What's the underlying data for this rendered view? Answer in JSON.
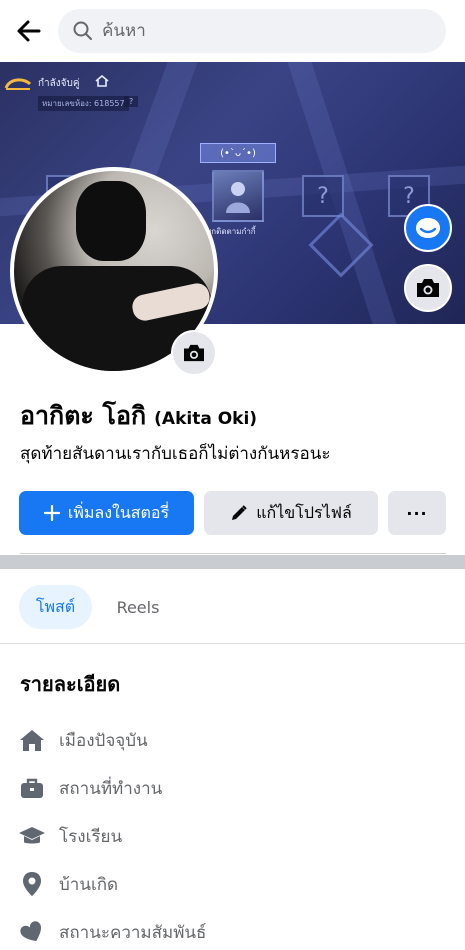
{
  "search": {
    "placeholder": "ค้นหา"
  },
  "cover": {
    "game_status": "กำลังจับคู่",
    "game_sub": "หมายเลขห้อง: 618557",
    "game_tag": "(•`ᴗ´•)",
    "slot_label": "?",
    "hero_caption": "พกติดตามกำกี้"
  },
  "profile": {
    "name": "อากิตะ โอกิ",
    "alt_name": "(Akita Oki)",
    "bio": "สุดท้ายสันดานเรากับเธอก็ไม่ต่างกันหรอนะ"
  },
  "actions": {
    "add_story": "เพิ่มลงในสตอรี่",
    "edit_profile": "แก้ไขโปรไฟล์",
    "more": "···"
  },
  "tabs": [
    {
      "label": "โพสต์",
      "active": true
    },
    {
      "label": "Reels",
      "active": false
    }
  ],
  "details": {
    "title": "รายละเอียด",
    "items": [
      {
        "icon": "home-icon",
        "label": "เมืองปัจจุบัน"
      },
      {
        "icon": "briefcase-icon",
        "label": "สถานที่ทำงาน"
      },
      {
        "icon": "graduation-cap-icon",
        "label": "โรงเรียน"
      },
      {
        "icon": "location-pin-icon",
        "label": "บ้านเกิด"
      },
      {
        "icon": "heart-icon",
        "label": "สถานะความสัมพันธ์"
      }
    ]
  },
  "colors": {
    "accent": "#1877f2",
    "secondary_bg": "#e4e6eb",
    "muted_text": "#65676b"
  }
}
